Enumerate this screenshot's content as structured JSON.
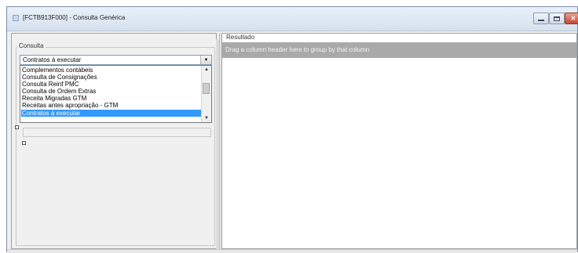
{
  "window": {
    "title": "[FCTB913F000] - Consulta Genérica"
  },
  "consulta": {
    "group_label": "Consulta",
    "selected_value": "Contratos à executar",
    "options": [
      "Complementos contábeis",
      "Consulta de Consignações",
      "Consulta Reinf PMC",
      "Consulta de Ordem Extras",
      "Receita Migradas GTM",
      "Receitas antes apropriação - GTM",
      "Contratos à executar"
    ],
    "highlighted_index": 6
  },
  "resultado": {
    "label": "Resultado",
    "group_hint": "Drag a column header here to group by that column"
  },
  "icons": {
    "minimize": "minimize-icon",
    "maximize": "maximize-icon",
    "close": "close-icon",
    "dropdown_arrow": "chevron-down-icon"
  },
  "colors": {
    "selection": "#3399ff",
    "group_bar": "#a9a9a9",
    "close_button": "#c24a34"
  }
}
